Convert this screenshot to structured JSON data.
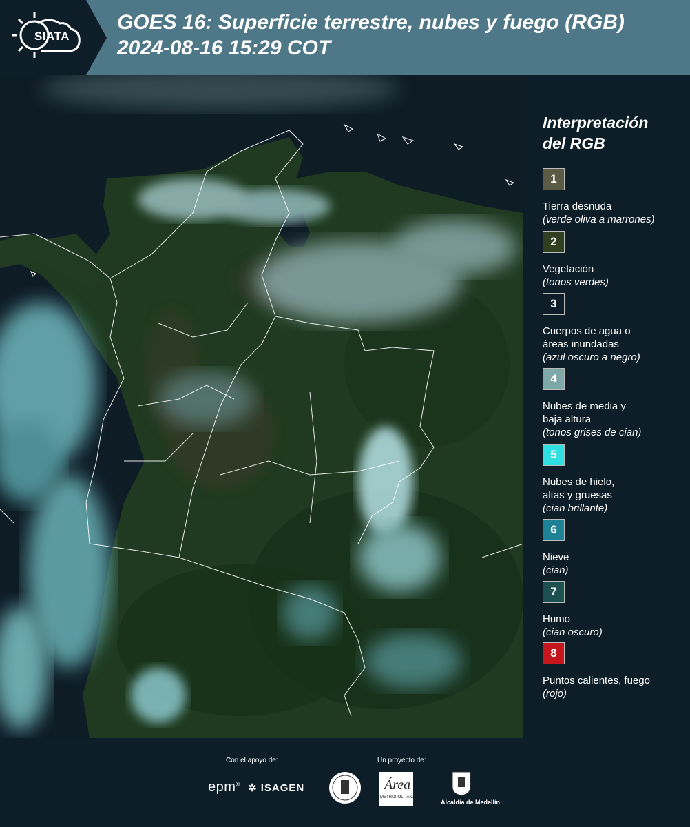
{
  "header": {
    "logo_text": "SIATA",
    "title_line1": "GOES 16: Superficie terrestre, nubes y fuego (RGB)",
    "title_line2": "2024-08-16 15:29 COT"
  },
  "map": {
    "description_icon": "satellite-rgb-map-colombia"
  },
  "legend": {
    "title_line1": "Interpretación",
    "title_line2": "del RGB",
    "items": [
      {
        "number": "1",
        "color": "#5a5a45",
        "label_lines": [
          "Tierra desnuda"
        ],
        "sub": "(verde oliva a marrones)"
      },
      {
        "number": "2",
        "color": "#2f3f1f",
        "label_lines": [
          "Vegetación"
        ],
        "sub": "(tonos verdes)"
      },
      {
        "number": "3",
        "color": "#0d1e29",
        "label_lines": [
          "Cuerpos de agua o",
          "áreas inundadas"
        ],
        "sub": "(azul oscuro a negro)"
      },
      {
        "number": "4",
        "color": "#7fa8a8",
        "label_lines": [
          "Nubes de media y",
          "baja altura"
        ],
        "sub": "(tonos grises de cian)"
      },
      {
        "number": "5",
        "color": "#2ee0e0",
        "label_lines": [
          "Nubes de hielo,",
          "altas y gruesas"
        ],
        "sub": "(cian brillante)"
      },
      {
        "number": "6",
        "color": "#1e8296",
        "label_lines": [
          "Nieve"
        ],
        "sub": "(cian)"
      },
      {
        "number": "7",
        "color": "#1d5050",
        "label_lines": [
          "Humo"
        ],
        "sub": "(cian oscuro)"
      },
      {
        "number": "8",
        "color": "#c4161c",
        "label_lines": [
          "Puntos calientes, fuego"
        ],
        "sub": "(rojo)"
      }
    ]
  },
  "footer": {
    "support_label": "Con el apoyo de:",
    "project_label": "Un proyecto de:",
    "epm": "epm",
    "isagen": "ISAGEN",
    "area_metropolitana": "Área",
    "area_sub": "METROPOLITANA",
    "alcaldia": "Alcaldía de Medellín"
  }
}
